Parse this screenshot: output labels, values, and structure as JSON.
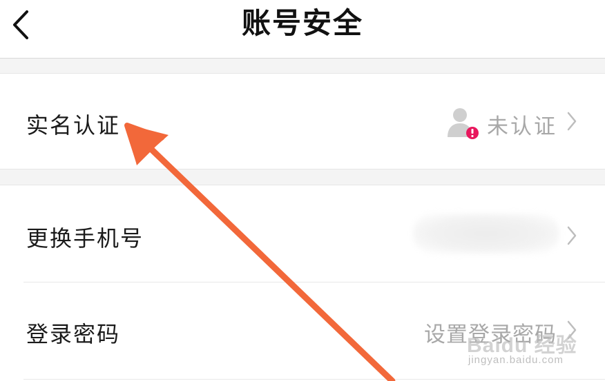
{
  "header": {
    "title": "账号安全",
    "back_icon": "chevron-left-icon"
  },
  "rows": {
    "real_name": {
      "label": "实名认证",
      "status": "未认证",
      "icon": "user-warning-icon",
      "warning_color": "#e8175d"
    },
    "change_phone": {
      "label": "更换手机号",
      "value_obscured": true
    },
    "login_password": {
      "label": "登录密码",
      "value": "设置登录密码"
    }
  },
  "annotation": {
    "type": "arrow",
    "color": "#f2683a",
    "points_to": "实名认证"
  },
  "watermark": {
    "logo": "Baidu 经验",
    "url": "jingyan.baidu.com"
  }
}
